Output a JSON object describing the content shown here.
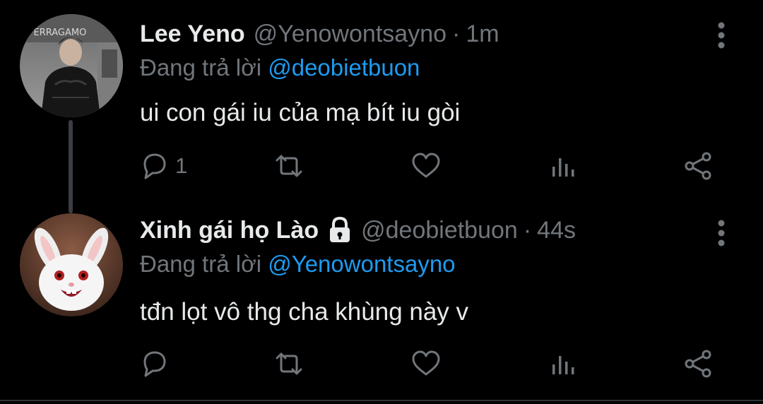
{
  "tweets": [
    {
      "author_name": "Lee Yeno",
      "handle": "@Yenowontsayno",
      "separator": "·",
      "time": "1m",
      "replying_prefix": "Đang trả lời",
      "replying_to": "@deobietbuon",
      "text": "ui con gái iu của mạ bít iu gòi",
      "reply_count": "1",
      "avatar_text": "FERRAGAMO",
      "locked": false
    },
    {
      "author_name": "Xinh gái họ Lào",
      "handle": "@deobietbuon",
      "separator": "·",
      "time": "44s",
      "replying_prefix": "Đang trả lời",
      "replying_to": "@Yenowontsayno",
      "text": "tđn lọt vô thg cha khùng này v",
      "reply_count": "",
      "locked": true
    }
  ],
  "icons": {
    "reply": "reply-icon",
    "retweet": "retweet-icon",
    "like": "heart-icon",
    "views": "views-icon",
    "share": "share-icon",
    "more": "more-vertical-icon",
    "lock": "lock-icon"
  },
  "colors": {
    "background": "#000000",
    "text": "#e7e9ea",
    "muted": "#71767b",
    "mention": "#1d9bf0",
    "thread_line": "#3a3d41"
  }
}
